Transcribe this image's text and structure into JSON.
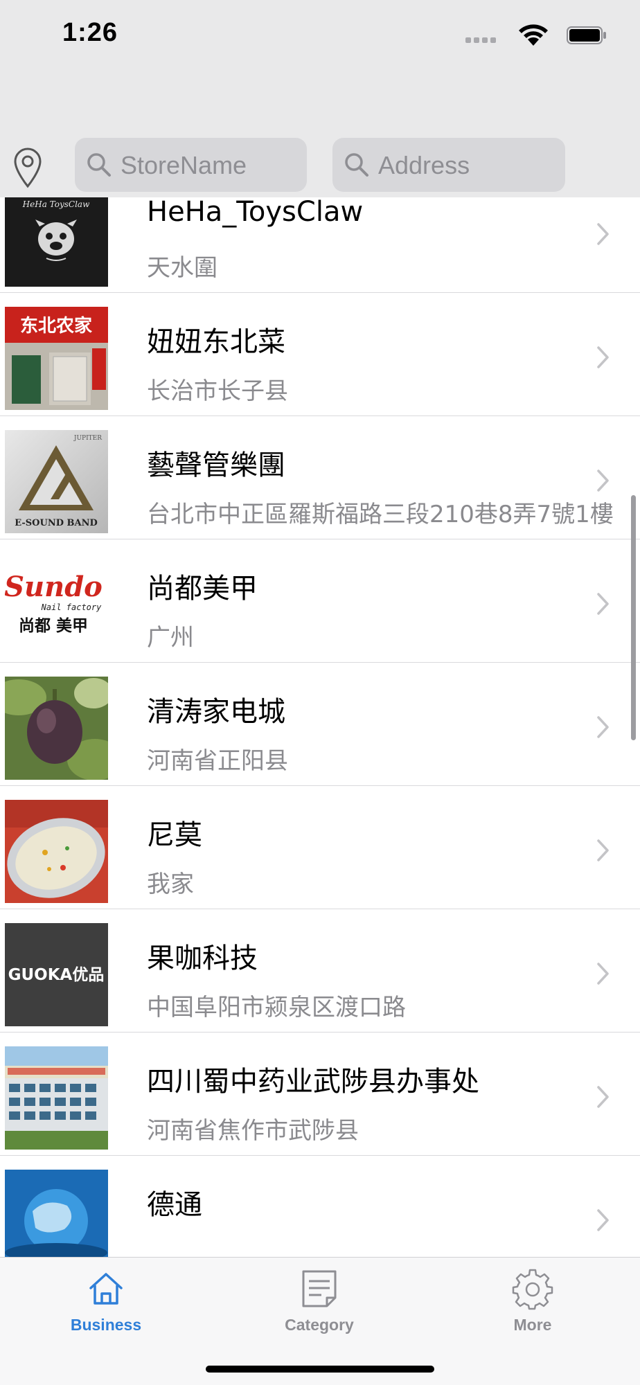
{
  "status_bar": {
    "time": "1:26"
  },
  "search": {
    "store_placeholder": "StoreName",
    "address_placeholder": "Address"
  },
  "stores": [
    {
      "name": "HeHa_ToysClaw",
      "address": "天水圍",
      "thumb_text": "HeHa ToysClaw"
    },
    {
      "name": "妞妞东北菜",
      "address": "长治市长子县",
      "thumb_text": "东北农家"
    },
    {
      "name": "藝聲管樂團",
      "address": "台北市中正區羅斯福路三段210巷8弄7號1樓",
      "thumb_text": "E-SOUND BAND",
      "thumb_subtext": "JUPITER"
    },
    {
      "name": "尚都美甲",
      "address": "广州",
      "thumb_text": "Sundo",
      "thumb_subtext": "Nail factory",
      "thumb_cn": "尚都 美甲"
    },
    {
      "name": "清涛家电城",
      "address": "河南省正阳县"
    },
    {
      "name": "尼莫",
      "address": "我家"
    },
    {
      "name": "果咖科技",
      "address": "中国阜阳市颍泉区渡口路",
      "thumb_text": "GUOKA优品"
    },
    {
      "name": "四川蜀中药业武陟县办事处",
      "address": "河南省焦作市武陟县"
    },
    {
      "name": "德通",
      "address": ""
    }
  ],
  "tabs": [
    {
      "label": "Business",
      "icon": "home-icon",
      "active": true
    },
    {
      "label": "Category",
      "icon": "document-icon",
      "active": false
    },
    {
      "label": "More",
      "icon": "gear-icon",
      "active": false
    }
  ],
  "colors": {
    "accent": "#2f7fd8",
    "inactive": "#8e8e93",
    "header_bg": "#e9e9ea",
    "search_field_bg": "#d7d7da"
  }
}
